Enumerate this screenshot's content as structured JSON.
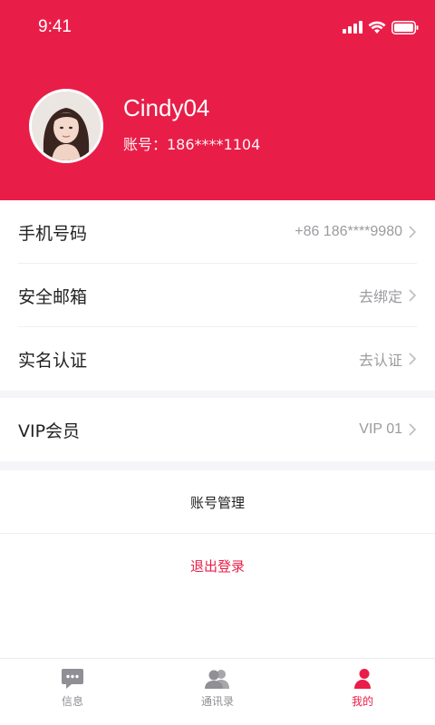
{
  "colors": {
    "accent": "#e91e48",
    "text": "#222222",
    "muted": "#9b9b9f",
    "background": "#f5f4f8"
  },
  "status_bar": {
    "time": "9:41"
  },
  "profile": {
    "name": "Cindy04",
    "account": "账号：186****1104"
  },
  "settings": {
    "phone": {
      "label": "手机号码",
      "value": "+86 186****9980"
    },
    "email": {
      "label": "安全邮箱",
      "value": "去绑定"
    },
    "identity": {
      "label": "实名认证",
      "value": "去认证"
    },
    "vip": {
      "label": "VIP会员",
      "value": "VIP 01"
    }
  },
  "actions": {
    "account_management": "账号管理",
    "logout": "退出登录"
  },
  "tabbar": {
    "tabs": [
      {
        "label": "信息",
        "icon": "chat-bubble-icon",
        "active": false
      },
      {
        "label": "通讯录",
        "icon": "contacts-icon",
        "active": false
      },
      {
        "label": "我的",
        "icon": "person-icon",
        "active": true
      }
    ]
  }
}
